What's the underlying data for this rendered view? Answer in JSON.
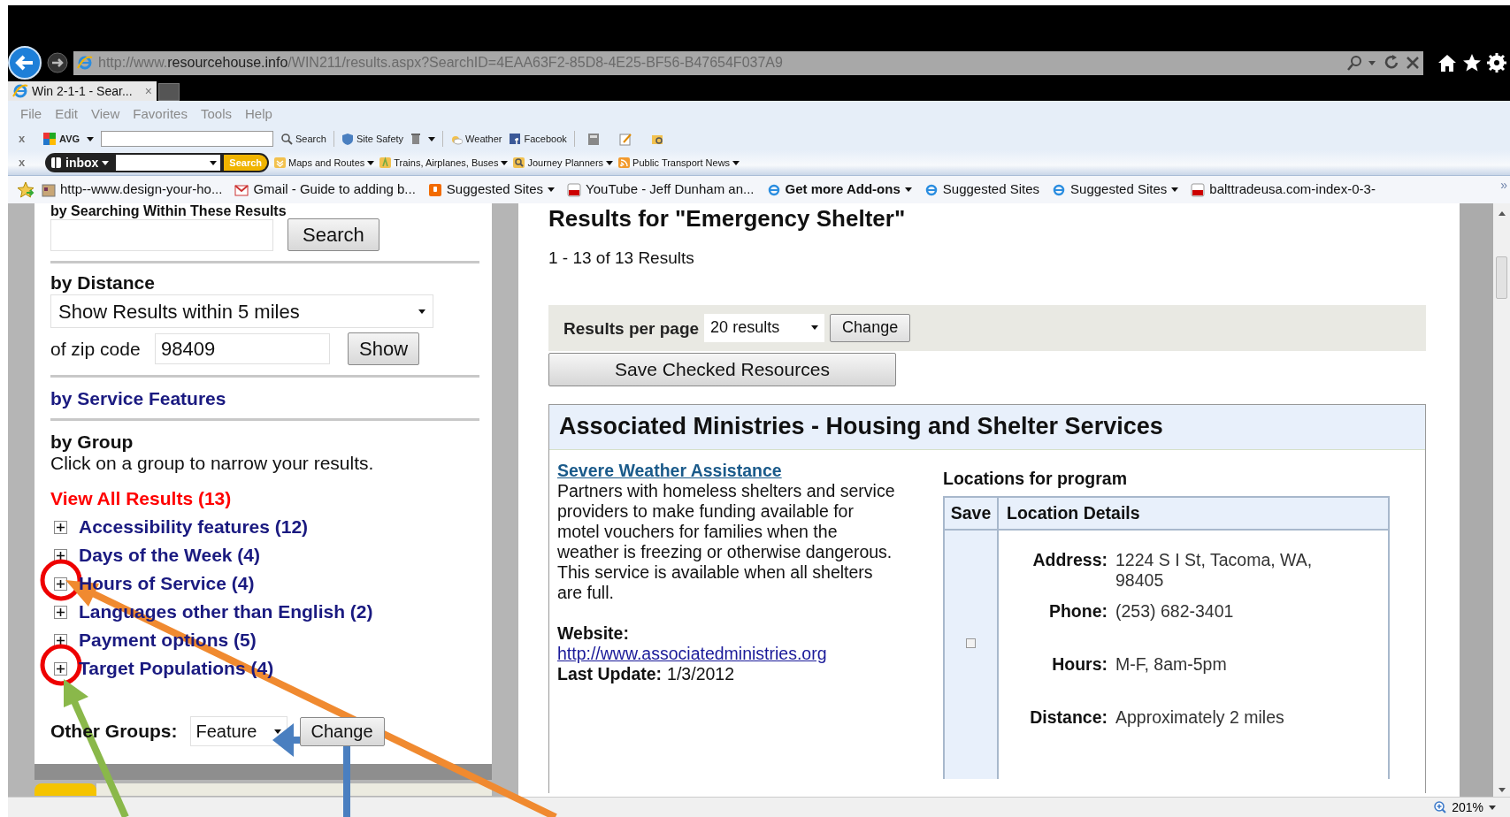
{
  "browser": {
    "url_parts": [
      {
        "text": "http://www.",
        "highlight": false
      },
      {
        "text": "resourcehouse.info",
        "highlight": true
      },
      {
        "text": "/WIN211/results.aspx?SearchID=4EAA63F2-85D8-4E25-BF56-B47654F037A9",
        "highlight": false
      }
    ],
    "tabs": [
      {
        "title": "Win 2-1-1 - Sear...",
        "close": "×",
        "selected": true
      }
    ]
  },
  "menu": [
    "File",
    "Edit",
    "View",
    "Favorites",
    "Tools",
    "Help"
  ],
  "avg_toolbar": {
    "close": "x",
    "brand": "AVG",
    "buttons": [
      "Search",
      "Site Safety",
      "Weather",
      "Facebook"
    ]
  },
  "inbox_toolbar": {
    "close": "x",
    "brand": "inbox",
    "search": "Search",
    "buttons": [
      "Maps and Routes",
      "Trains, Airplanes, Buses",
      "Journey Planners",
      "Public Transport News"
    ]
  },
  "favorites": [
    {
      "label": "http--www.design-your-ho...",
      "bold": false,
      "dropdown": false
    },
    {
      "label": "Gmail - Guide to adding b...",
      "bold": false,
      "dropdown": false
    },
    {
      "label": "Suggested Sites",
      "bold": false,
      "dropdown": true
    },
    {
      "label": "YouTube - Jeff Dunham an...",
      "bold": false,
      "dropdown": false
    },
    {
      "label": "Get more Add-ons",
      "bold": true,
      "dropdown": true
    },
    {
      "label": "Suggested Sites",
      "bold": false,
      "dropdown": false
    },
    {
      "label": "Suggested Sites",
      "bold": false,
      "dropdown": true
    },
    {
      "label": "balttradeusa.com-index-0-3-",
      "bold": false,
      "dropdown": false
    }
  ],
  "favorites_more": "»",
  "filters": {
    "search_heading": "by Searching Within These Results",
    "search_button": "Search",
    "distance_heading": "by Distance",
    "distance_select": "Show Results within 5 miles",
    "zip_label": "of zip code",
    "zip_value": "98409",
    "show_button": "Show",
    "features_link": "by Service Features",
    "group_heading": "by Group",
    "group_hint": "Click on a group to narrow your results.",
    "view_all": "View All Results (13)",
    "groups": [
      {
        "label": "Accessibility features (12)",
        "expanded": false
      },
      {
        "label": "Days of the Week (4)",
        "expanded": false
      },
      {
        "label": "Hours of Service (4)",
        "expanded": false
      },
      {
        "label": "Languages other than English (2)",
        "expanded": false
      },
      {
        "label": "Payment options (5)",
        "expanded": false
      },
      {
        "label": "Target Populations (4)",
        "expanded": false
      }
    ],
    "other_groups_label": "Other Groups:",
    "other_groups_select": "Feature",
    "other_groups_button": "Change"
  },
  "results": {
    "title": "Results for \"Emergency Shelter\"",
    "count": "1 - 13 of 13 Results",
    "per_page_label": "Results per page",
    "per_page_select": "20 results",
    "per_page_button": "Change",
    "save_button": "Save Checked Resources",
    "card": {
      "heading": "Associated Ministries - Housing and Shelter Services",
      "program_link": "Severe Weather Assistance",
      "description": "Partners with homeless shelters and service providers to make funding available for motel vouchers for families when the weather is freezing or otherwise dangerous. This service is available when all shelters are full.",
      "website_label": "Website:",
      "website_url": "http://www.associatedministries.org",
      "last_update_label": "Last Update:",
      "last_update": "1/3/2012",
      "locations_heading": "Locations for program",
      "columns": [
        "Save",
        "Location Details"
      ],
      "location": {
        "checked": false,
        "details": [
          {
            "label": "Address:",
            "value": "1224 S I St, Tacoma, WA, 98405"
          },
          {
            "label": "Phone:",
            "value": "(253) 682-3401"
          },
          {
            "label": "Hours:",
            "value": "M-F, 8am-5pm"
          },
          {
            "label": "Distance:",
            "value": "Approximately 2 miles"
          }
        ]
      }
    }
  },
  "status_bar": {
    "zoom": "201%"
  }
}
